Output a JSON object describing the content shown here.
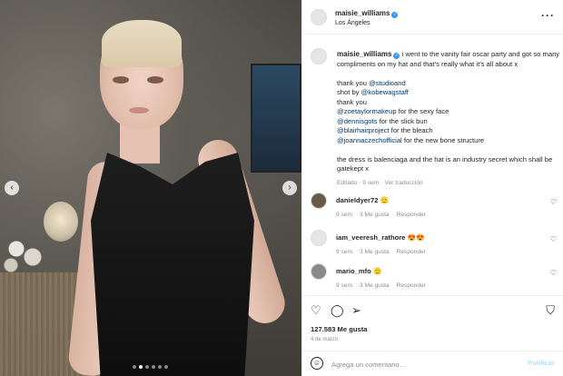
{
  "post": {
    "username": "maisie_williams",
    "location": "Los Ángeles",
    "more_icon": "more-horizontal-icon",
    "caption": {
      "text": "i went to the vanity fair oscar party and got so many compliments on my hat and that's really what it's all about x",
      "thanks_prefix": "thank you ",
      "thanks_handle": "@studioand",
      "shot_prefix": "shot by ",
      "shot_handle": "@kobewagstaff",
      "thank_you": "thank you",
      "credits": [
        {
          "handle": "@zoetaylormakeup",
          "text": " for the sexy face"
        },
        {
          "handle": "@dennisgots",
          "text": " for the slick bun"
        },
        {
          "handle": "@blairhairproject",
          "text": " for the bleach"
        },
        {
          "handle": "@joannaczechofficial",
          "text": " for the new bone structure"
        }
      ],
      "closing": "the dress is balenciaga and the hat is an industry secret which shall be gatekept x",
      "edited": "Editado · 9 sem",
      "translation": "Ver traducción"
    },
    "comments": [
      {
        "username": "danieldyer72",
        "emoji": "🫡",
        "time": "9 sem",
        "likes": "3 Me gusta",
        "reply": "Responder"
      },
      {
        "username": "iam_veeresh_rathore",
        "emoji": "😍😍",
        "time": "9 sem",
        "likes": "3 Me gusta",
        "reply": "Responder"
      },
      {
        "username": "mario_mfo",
        "emoji": "🫡",
        "time": "9 sem",
        "likes": "3 Me gusta",
        "reply": "Responder"
      }
    ],
    "likes": "127.583 Me gusta",
    "date": "4 de marzo",
    "comment_placeholder": "Agrega un comentario...",
    "post_button": "Publicar",
    "carousel": {
      "slides": 6,
      "active": 1
    }
  },
  "colors": {
    "link": "#00376b",
    "verified": "#3897f0",
    "muted": "#8e8e8e",
    "post_disabled": "#b2dffc"
  }
}
